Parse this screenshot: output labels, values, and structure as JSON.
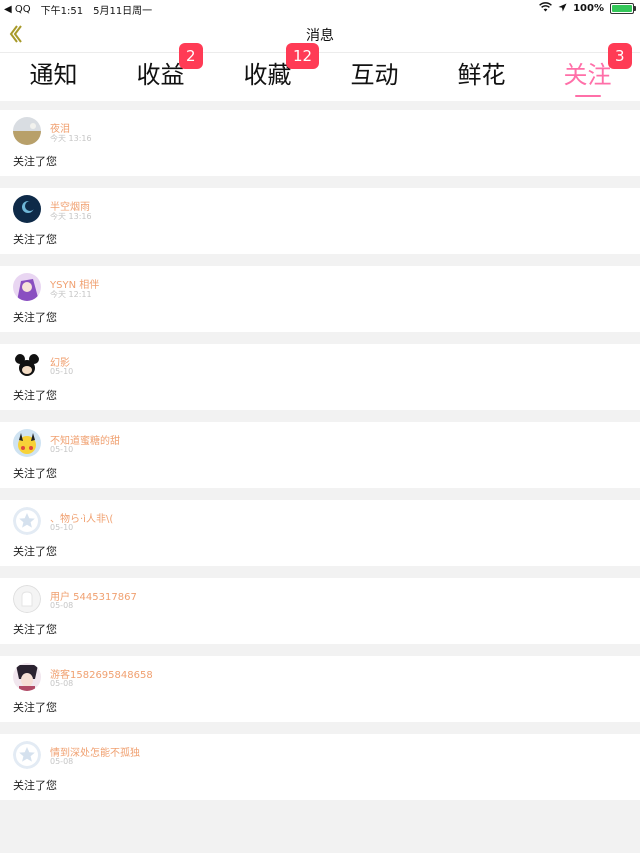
{
  "status_bar": {
    "back_app": "◀ QQ",
    "time": "下午1:51",
    "date": "5月11日周一",
    "battery": "100%"
  },
  "nav": {
    "title": "消息"
  },
  "tabs": [
    {
      "label": "通知",
      "badge": ""
    },
    {
      "label": "收益",
      "badge": "2"
    },
    {
      "label": "收藏",
      "badge": "12"
    },
    {
      "label": "互动",
      "badge": ""
    },
    {
      "label": "鲜花",
      "badge": ""
    },
    {
      "label": "关注",
      "badge": "3",
      "active": true
    }
  ],
  "notifications": [
    {
      "name": "夜泪",
      "time": "今天 13:16",
      "message": "关注了您",
      "avatar": "landscape"
    },
    {
      "name": "半空烟雨",
      "time": "今天 13:16",
      "message": "关注了您",
      "avatar": "moon-night"
    },
    {
      "name": "YSYN 相伴",
      "time": "今天 12:11",
      "message": "关注了您",
      "avatar": "purple-anime"
    },
    {
      "name": "幻影",
      "time": "05-10",
      "message": "关注了您",
      "avatar": "mickey"
    },
    {
      "name": "不知道蜜糖的甜",
      "time": "05-10",
      "message": "关注了您",
      "avatar": "pikachu"
    },
    {
      "name": "、物ら·ì人非\\(",
      "time": "05-10",
      "message": "关注了您",
      "avatar": "default-star"
    },
    {
      "name": "用户 5445317867",
      "time": "05-08",
      "message": "关注了您",
      "avatar": "default-blank"
    },
    {
      "name": "游客1582695848658",
      "time": "05-08",
      "message": "关注了您",
      "avatar": "anime-girl"
    },
    {
      "name": "情到深处怎能不孤独",
      "time": "05-08",
      "message": "关注了您",
      "avatar": "default-star"
    }
  ],
  "colors": {
    "accent": "#ff6fa8",
    "badge": "#ff3b55",
    "username": "#f0a070",
    "timestamp": "#c6c6c6",
    "background": "#f2f2f2"
  }
}
